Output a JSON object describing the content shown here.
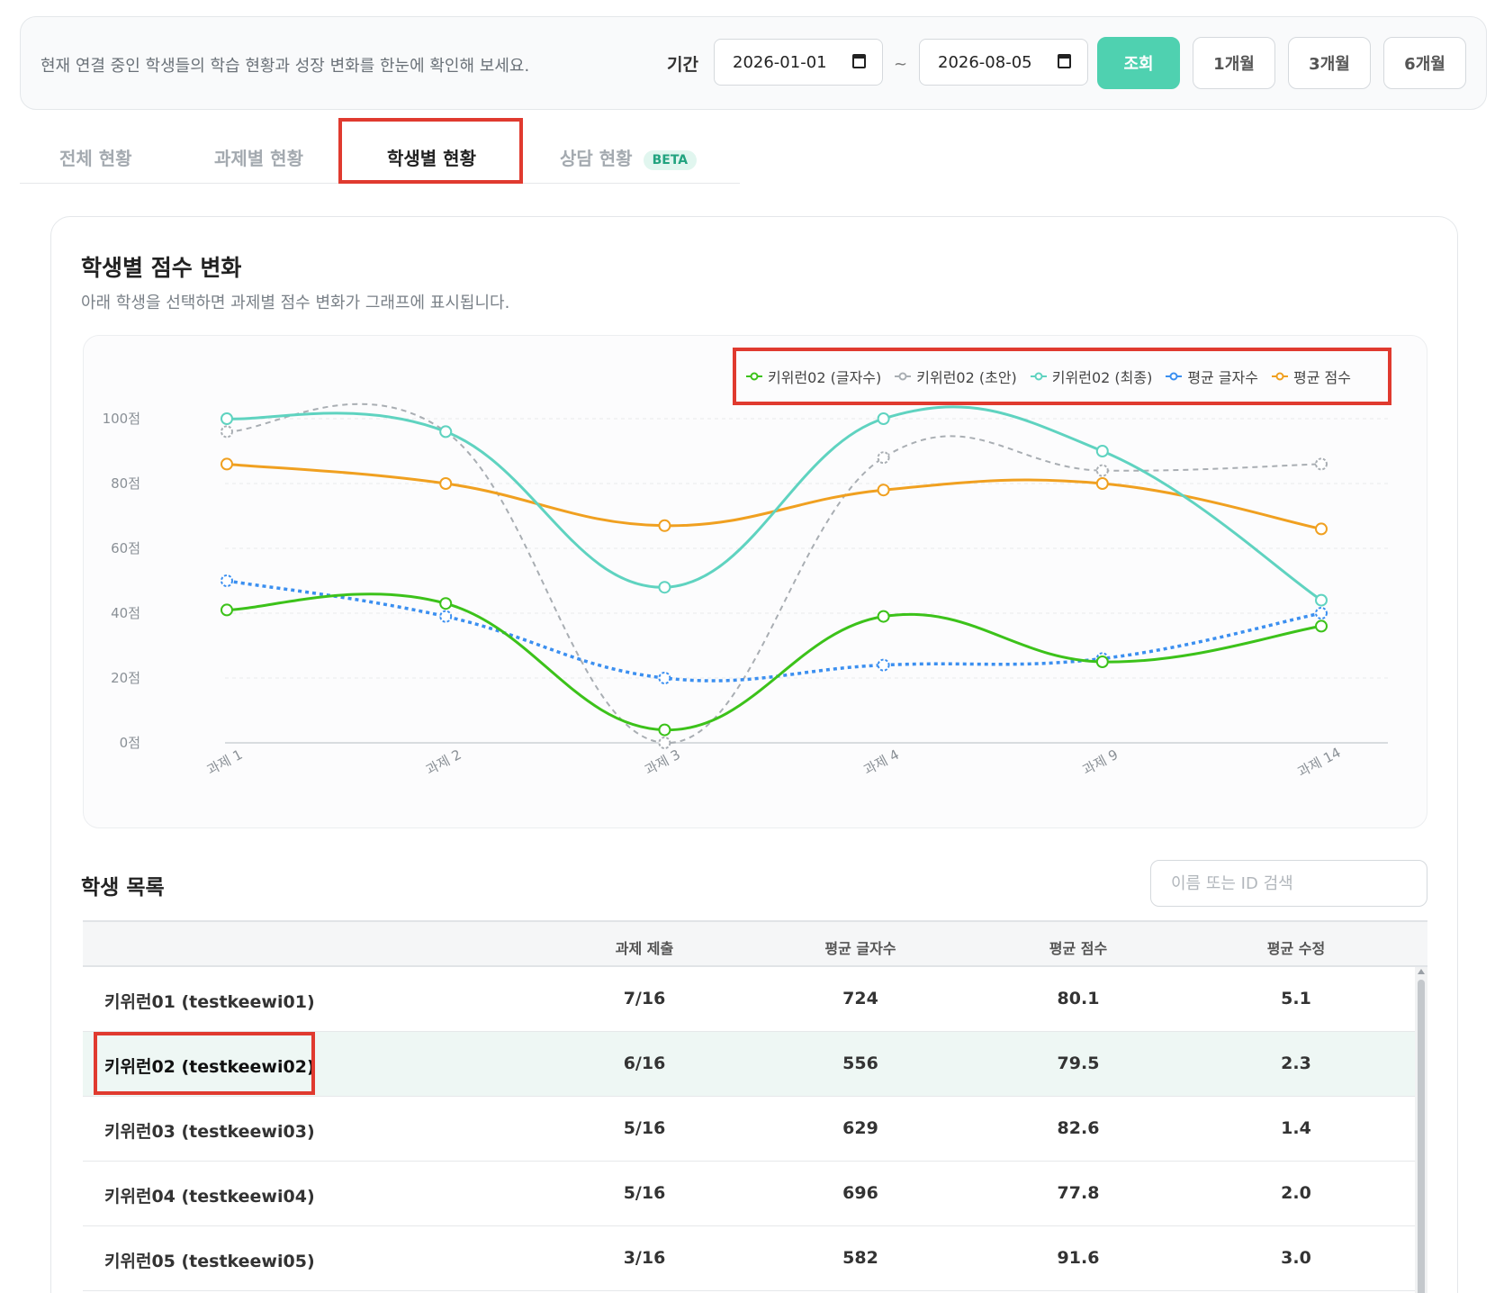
{
  "header": {
    "description": "현재 연결 중인 학생들의 학습 현황과 성장 변화를 한눈에 확인해 보세요.",
    "period_label": "기간",
    "start_date": "2026-01-01",
    "end_date": "2026-08-05",
    "tilde": "~",
    "search_button": "조회",
    "range_buttons": [
      "1개월",
      "3개월",
      "6개월"
    ],
    "accent_color": "#4fd1b0"
  },
  "tabs": [
    {
      "label": "전체 현황",
      "active": false
    },
    {
      "label": "과제별 현황",
      "active": false
    },
    {
      "label": "학생별 현황",
      "active": true
    },
    {
      "label": "상담 현황",
      "active": false,
      "badge": "BETA"
    }
  ],
  "card": {
    "title": "학생별 점수 변화",
    "subtitle": "아래 학생을 선택하면 과제별 점수 변화가 그래프에 표시됩니다."
  },
  "chart_data": {
    "type": "line",
    "categories": [
      "과제 1",
      "과제 2",
      "과제 3",
      "과제 4",
      "과제 9",
      "과제 14"
    ],
    "ylim": [
      0,
      100
    ],
    "y_ticks": [
      "0점",
      "20점",
      "40점",
      "60점",
      "80점",
      "100점"
    ],
    "grid": true,
    "legend_position": "top-right",
    "series": [
      {
        "name": "키위런02 (글자수)",
        "color": "#3cc21a",
        "dashed": false,
        "values": [
          41,
          43,
          4,
          39,
          25,
          36
        ]
      },
      {
        "name": "키위런02 (초안)",
        "color": "#a9aeb3",
        "dashed": true,
        "values": [
          96,
          96,
          0,
          88,
          84,
          86
        ]
      },
      {
        "name": "키위런02 (최종)",
        "color": "#5fd3c0",
        "dashed": false,
        "values": [
          100,
          96,
          48,
          100,
          90,
          44
        ]
      },
      {
        "name": "평균 글자수",
        "color": "#3b8ff0",
        "dashed": true,
        "values": [
          50,
          39,
          20,
          24,
          26,
          40
        ]
      },
      {
        "name": "평균 점수",
        "color": "#f0a020",
        "dashed": false,
        "values": [
          86,
          80,
          67,
          78,
          80,
          66
        ]
      }
    ]
  },
  "list": {
    "title": "학생 목록",
    "search_placeholder": "이름 또는 ID 검색",
    "columns": [
      "과제 제출",
      "평균 글자수",
      "평균 점수",
      "평균 수정"
    ],
    "rows": [
      {
        "name": "키위런01 (testkeewi01)",
        "submitted": "7/16",
        "avg_chars": "724",
        "avg_score": "80.1",
        "avg_edits": "5.1",
        "selected": false
      },
      {
        "name": "키위런02 (testkeewi02)",
        "submitted": "6/16",
        "avg_chars": "556",
        "avg_score": "79.5",
        "avg_edits": "2.3",
        "selected": true
      },
      {
        "name": "키위런03 (testkeewi03)",
        "submitted": "5/16",
        "avg_chars": "629",
        "avg_score": "82.6",
        "avg_edits": "1.4",
        "selected": false
      },
      {
        "name": "키위런04 (testkeewi04)",
        "submitted": "5/16",
        "avg_chars": "696",
        "avg_score": "77.8",
        "avg_edits": "2.0",
        "selected": false
      },
      {
        "name": "키위런05 (testkeewi05)",
        "submitted": "3/16",
        "avg_chars": "582",
        "avg_score": "91.6",
        "avg_edits": "3.0",
        "selected": false
      }
    ]
  }
}
